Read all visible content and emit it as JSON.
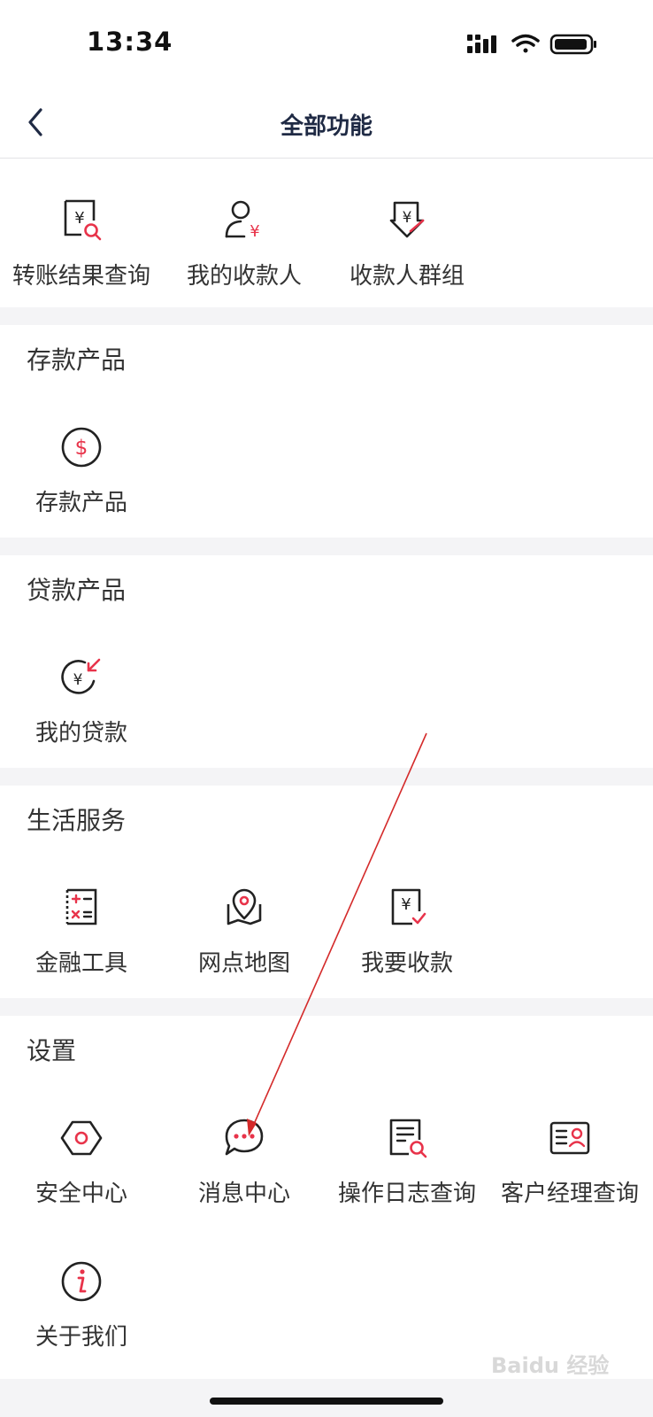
{
  "status": {
    "time": "13:34"
  },
  "nav": {
    "title": "全部功能"
  },
  "transfer": {
    "items": [
      {
        "label": "转账结果查询",
        "icon": "transfer-query-icon"
      },
      {
        "label": "我的收款人",
        "icon": "payee-icon"
      },
      {
        "label": "收款人群组",
        "icon": "payee-group-icon"
      }
    ]
  },
  "deposit": {
    "title": "存款产品",
    "items": [
      {
        "label": "存款产品",
        "icon": "dollar-circle-icon"
      }
    ]
  },
  "loan": {
    "title": "贷款产品",
    "items": [
      {
        "label": "我的贷款",
        "icon": "loan-icon"
      }
    ]
  },
  "life": {
    "title": "生活服务",
    "items": [
      {
        "label": "金融工具",
        "icon": "calculator-icon"
      },
      {
        "label": "网点地图",
        "icon": "map-pin-icon"
      },
      {
        "label": "我要收款",
        "icon": "receive-money-icon"
      }
    ]
  },
  "settings": {
    "title": "设置",
    "items": [
      {
        "label": "安全中心",
        "icon": "security-icon"
      },
      {
        "label": "消息中心",
        "icon": "message-icon"
      },
      {
        "label": "操作日志查询",
        "icon": "log-query-icon"
      },
      {
        "label": "客户经理查询",
        "icon": "manager-card-icon"
      },
      {
        "label": "关于我们",
        "icon": "info-icon"
      }
    ]
  },
  "watermark": {
    "text": "Baidu 经验"
  },
  "colors": {
    "accent": "#e8334a",
    "ink": "#1f2a44",
    "text": "#333333"
  }
}
